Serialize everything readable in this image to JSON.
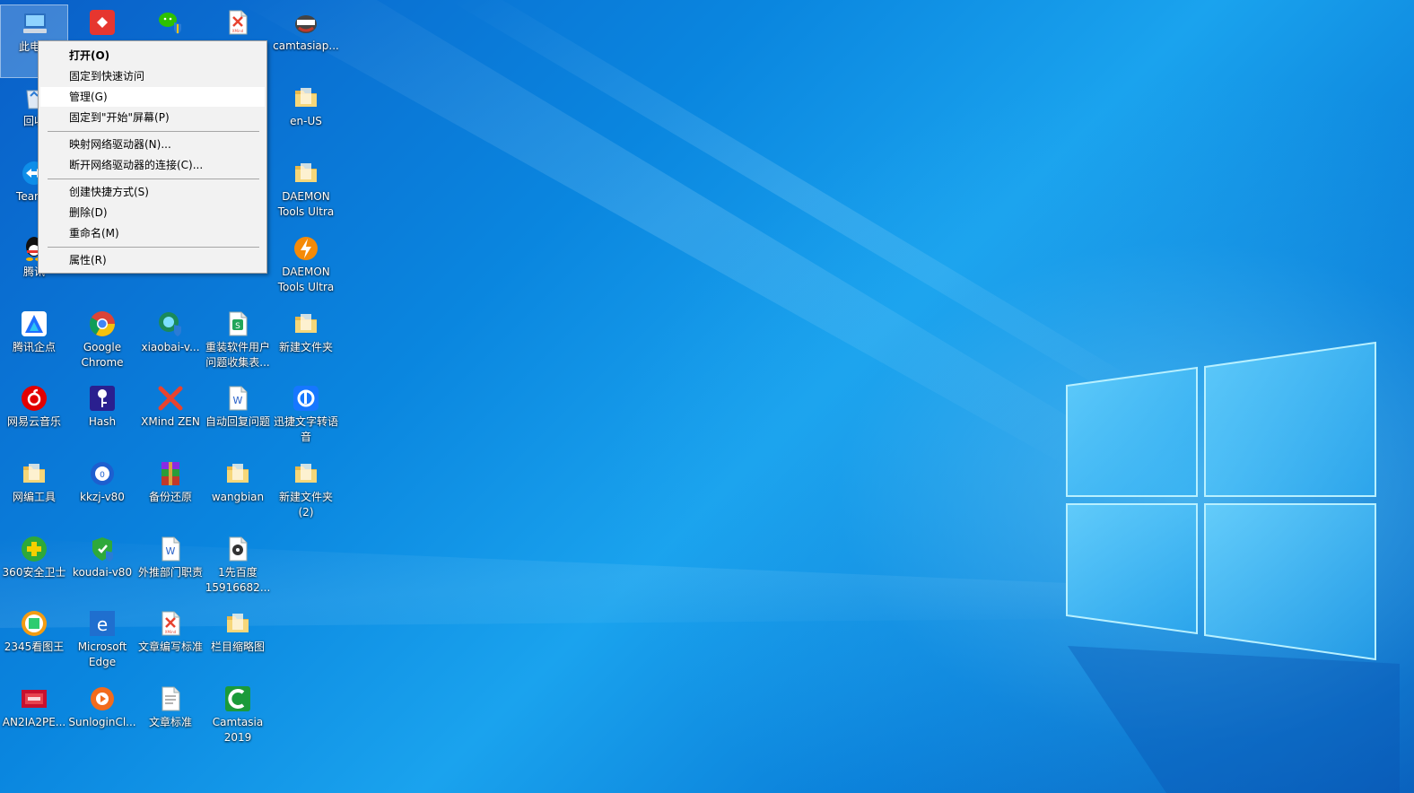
{
  "desktop": {
    "icons": [
      {
        "label": "此电脑",
        "icon": "computer-icon"
      },
      {
        "label": "",
        "icon": "red-app-icon"
      },
      {
        "label": "",
        "icon": "wechat-shield-icon"
      },
      {
        "label": "",
        "icon": "xmind-file-icon"
      },
      {
        "label": "camtasiap...",
        "icon": "camtasia-installer-icon"
      },
      {
        "label": "回收",
        "icon": "recycle-bin-icon"
      },
      {
        "label": "en-US",
        "icon": "folder-icon"
      },
      {
        "label": "TeamV",
        "icon": "teamviewer-icon"
      },
      {
        "label": "DAEMON\nTools Ultra",
        "icon": "folder-icon"
      },
      {
        "label": "腾讯",
        "icon": "qq-icon"
      },
      {
        "label": "DAEMON\nTools Ultra",
        "icon": "daemon-tools-icon"
      },
      {
        "label": "腾讯企点",
        "icon": "tencent-qidian-icon"
      },
      {
        "label": "Google\nChrome",
        "icon": "chrome-icon"
      },
      {
        "label": "xiaobai-v...",
        "icon": "xiaobai-icon"
      },
      {
        "label": "重装软件用户\n问题收集表...",
        "icon": "spreadsheet-icon"
      },
      {
        "label": "新建文件夹",
        "icon": "folder-icon"
      },
      {
        "label": "网易云音乐",
        "icon": "netease-music-icon"
      },
      {
        "label": "Hash",
        "icon": "hash-key-icon"
      },
      {
        "label": "XMind ZEN",
        "icon": "xmind-icon"
      },
      {
        "label": "自动回复问题",
        "icon": "word-doc-icon"
      },
      {
        "label": "迅捷文字转语\n音",
        "icon": "xunjie-icon"
      },
      {
        "label": "网编工具",
        "icon": "folder-icon"
      },
      {
        "label": "kkzj-v80",
        "icon": "kkzj-icon"
      },
      {
        "label": "备份还原",
        "icon": "winrar-icon"
      },
      {
        "label": "wangbian",
        "icon": "folder-icon"
      },
      {
        "label": "新建文件夹\n(2)",
        "icon": "folder-icon"
      },
      {
        "label": "360安全卫士",
        "icon": "360-security-icon"
      },
      {
        "label": "koudai-v80",
        "icon": "koudai-shield-icon"
      },
      {
        "label": "外推部门职责",
        "icon": "word-doc-icon"
      },
      {
        "label": "1先百度\n15916682...",
        "icon": "media-file-icon"
      },
      {
        "label": "2345看图王",
        "icon": "2345-viewer-icon"
      },
      {
        "label": "Microsoft\nEdge",
        "icon": "edge-icon"
      },
      {
        "label": "文章编写标准",
        "icon": "xmind-file-icon"
      },
      {
        "label": "栏目缩略图",
        "icon": "folder-icon"
      },
      {
        "label": "AN2IA2PE...",
        "icon": "image-file-icon"
      },
      {
        "label": "SunloginCl...",
        "icon": "sunlogin-icon"
      },
      {
        "label": "文章标准",
        "icon": "text-file-icon"
      },
      {
        "label": "Camtasia\n2019",
        "icon": "camtasia-icon"
      }
    ]
  },
  "context_menu": {
    "items": [
      {
        "label": "打开(O)",
        "bold": true
      },
      {
        "label": "固定到快速访问"
      },
      {
        "label": "管理(G)",
        "highlighted": true
      },
      {
        "label": "固定到\"开始\"屏幕(P)"
      },
      {
        "label": "映射网络驱动器(N)..."
      },
      {
        "label": "断开网络驱动器的连接(C)..."
      },
      {
        "label": "创建快捷方式(S)"
      },
      {
        "label": "删除(D)"
      },
      {
        "label": "重命名(M)"
      },
      {
        "label": "属性(R)"
      }
    ]
  },
  "colors": {
    "desktop_blue": "#0a86df",
    "menu_bg": "#f2f2f2",
    "menu_highlight": "#ffffff"
  }
}
